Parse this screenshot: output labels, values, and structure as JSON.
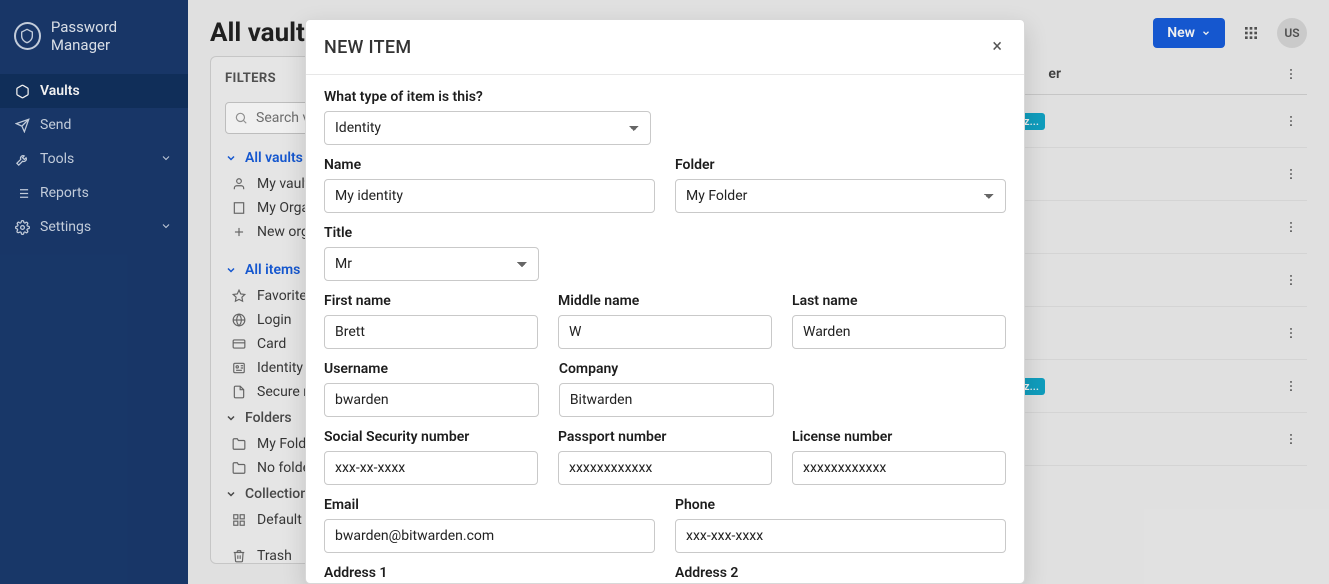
{
  "app_name": "Password Manager",
  "sidebar": {
    "items": [
      {
        "label": "Vaults",
        "icon": "cube-icon",
        "active": true,
        "expandable": false
      },
      {
        "label": "Send",
        "icon": "send-icon",
        "active": false,
        "expandable": false
      },
      {
        "label": "Tools",
        "icon": "wrench-icon",
        "active": false,
        "expandable": true
      },
      {
        "label": "Reports",
        "icon": "list-icon",
        "active": false,
        "expandable": false
      },
      {
        "label": "Settings",
        "icon": "gear-icon",
        "active": false,
        "expandable": true
      }
    ]
  },
  "header": {
    "page_title": "All vaults",
    "new_button": "New",
    "avatar_initials": "US"
  },
  "filters": {
    "title": "FILTERS",
    "search_placeholder": "Search va",
    "vaults_head": "All vaults",
    "vault_rows": [
      {
        "icon": "user-icon",
        "label": "My vault"
      },
      {
        "icon": "building-icon",
        "label": "My Organ"
      },
      {
        "icon": "plus-icon",
        "label": "New orga"
      }
    ],
    "items_head": "All items",
    "item_rows": [
      {
        "icon": "star-icon",
        "label": "Favorites"
      },
      {
        "icon": "globe-icon",
        "label": "Login"
      },
      {
        "icon": "card-icon",
        "label": "Card"
      },
      {
        "icon": "id-icon",
        "label": "Identity"
      },
      {
        "icon": "note-icon",
        "label": "Secure no"
      }
    ],
    "folders_head": "Folders",
    "folder_rows": [
      {
        "icon": "folder-icon",
        "label": "My Folder"
      },
      {
        "icon": "folder-icon",
        "label": "No folder"
      }
    ],
    "collections_head": "Collections",
    "collection_rows": [
      {
        "icon": "collection-icon",
        "label": "Default co"
      }
    ],
    "trash_label": "Trash"
  },
  "list": {
    "owner_col": "er",
    "rows": [
      {
        "badge": "Organiz..."
      },
      {
        "badge": ""
      },
      {
        "badge": ""
      },
      {
        "badge": ""
      },
      {
        "badge": ""
      },
      {
        "badge": "Organiz..."
      },
      {
        "badge": ""
      }
    ]
  },
  "modal": {
    "title": "NEW ITEM",
    "type_label": "What type of item is this?",
    "type_value": "Identity",
    "name_label": "Name",
    "name_value": "My identity",
    "folder_label": "Folder",
    "folder_value": "My Folder",
    "title_label": "Title",
    "title_value": "Mr",
    "first_name_label": "First name",
    "first_name_value": "Brett",
    "middle_name_label": "Middle name",
    "middle_name_value": "W",
    "last_name_label": "Last name",
    "last_name_value": "Warden",
    "username_label": "Username",
    "username_value": "bwarden",
    "company_label": "Company",
    "company_value": "Bitwarden",
    "ssn_label": "Social Security number",
    "ssn_value": "xxx-xx-xxxx",
    "passport_label": "Passport number",
    "passport_value": "xxxxxxxxxxxx",
    "license_label": "License number",
    "license_value": "xxxxxxxxxxxx",
    "email_label": "Email",
    "email_value": "bwarden@bitwarden.com",
    "phone_label": "Phone",
    "phone_value": "xxx-xxx-xxxx",
    "address1_label": "Address 1",
    "address2_label": "Address 2"
  }
}
